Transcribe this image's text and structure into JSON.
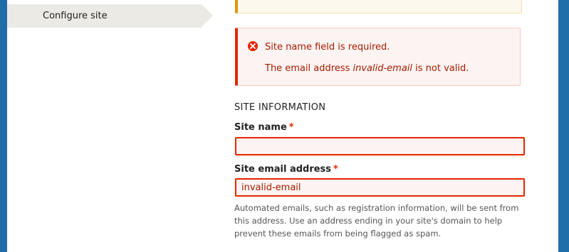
{
  "sidebar": {
    "current_step": "Configure site"
  },
  "messages": {
    "errors": {
      "line1": "Site name field is required.",
      "line2_prefix": "The email address ",
      "line2_value": "invalid-email",
      "line2_suffix": " is not valid."
    }
  },
  "form": {
    "section_title": "SITE INFORMATION",
    "site_name": {
      "label": "Site name",
      "required_marker": "*",
      "value": ""
    },
    "site_email": {
      "label": "Site email address",
      "required_marker": "*",
      "value": "invalid-email",
      "help": "Automated emails, such as registration information, will be sent from this address. Use an address ending in your site's domain to help prevent these emails from being flagged as spam."
    }
  },
  "colors": {
    "error_red": "#e32700",
    "warning_orange": "#e09600",
    "frame_blue": "#1f6eaa"
  }
}
